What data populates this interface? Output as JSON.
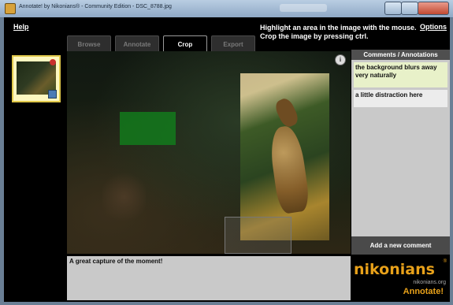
{
  "window": {
    "title": "Annotate! by Nikonians® - Community Edition - DSC_8788.jpg"
  },
  "menu": {
    "help": "Help",
    "options": "Options"
  },
  "instruction": "Highlight an area in the image with the mouse. Crop the image by pressing ctrl.",
  "tabs": [
    {
      "label": "Browse",
      "active": false
    },
    {
      "label": "Annotate",
      "active": false
    },
    {
      "label": "Crop",
      "active": true
    },
    {
      "label": "Export",
      "active": false
    }
  ],
  "comments": {
    "header": "Comments / Annotations",
    "items": [
      "the background blurs away very naturally",
      "a little distraction here"
    ],
    "add_button": "Add a new comment"
  },
  "caption": "A great capture of the moment!",
  "logo": {
    "wordmark": "nikonians",
    "reg": "®",
    "url": "nikonians.org",
    "product": "Annotate!"
  },
  "colors": {
    "accent": "#e8a11a",
    "annotation_box": "#137a1c"
  }
}
